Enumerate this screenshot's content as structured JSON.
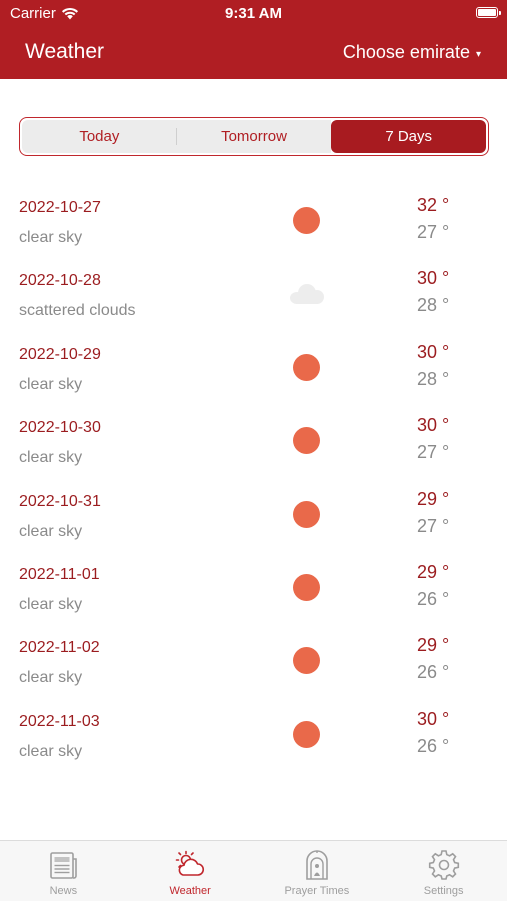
{
  "status_bar": {
    "carrier": "Carrier",
    "time": "9:31 AM"
  },
  "header": {
    "title": "Weather",
    "emirate_label": "Choose emirate",
    "caret": "▾"
  },
  "segments": [
    {
      "label": "Today",
      "selected": false
    },
    {
      "label": "Tomorrow",
      "selected": false
    },
    {
      "label": "7 Days",
      "selected": true
    }
  ],
  "forecast": [
    {
      "date": "2022-10-27",
      "desc": "clear sky",
      "icon": "sun-icon",
      "max": "32 °",
      "min": "27 °"
    },
    {
      "date": "2022-10-28",
      "desc": "scattered clouds",
      "icon": "cloud-icon",
      "max": "30 °",
      "min": "28 °"
    },
    {
      "date": "2022-10-29",
      "desc": "clear sky",
      "icon": "sun-icon",
      "max": "30 °",
      "min": "28 °"
    },
    {
      "date": "2022-10-30",
      "desc": "clear sky",
      "icon": "sun-icon",
      "max": "30 °",
      "min": "27 °"
    },
    {
      "date": "2022-10-31",
      "desc": "clear sky",
      "icon": "sun-icon",
      "max": "29 °",
      "min": "27 °"
    },
    {
      "date": "2022-11-01",
      "desc": "clear sky",
      "icon": "sun-icon",
      "max": "29 °",
      "min": "26 °"
    },
    {
      "date": "2022-11-02",
      "desc": "clear sky",
      "icon": "sun-icon",
      "max": "29 °",
      "min": "26 °"
    },
    {
      "date": "2022-11-03",
      "desc": "clear sky",
      "icon": "sun-icon",
      "max": "30 °",
      "min": "26 °"
    }
  ],
  "tabbar": [
    {
      "label": "News",
      "icon": "newspaper-icon",
      "active": false
    },
    {
      "label": "Weather",
      "icon": "weather-icon",
      "active": true
    },
    {
      "label": "Prayer Times",
      "icon": "mosque-icon",
      "active": false
    },
    {
      "label": "Settings",
      "icon": "gear-icon",
      "active": false
    }
  ],
  "colors": {
    "brand_red": "#b01e23",
    "sun": "#e9694a",
    "text_gray": "#8a8a8a"
  }
}
